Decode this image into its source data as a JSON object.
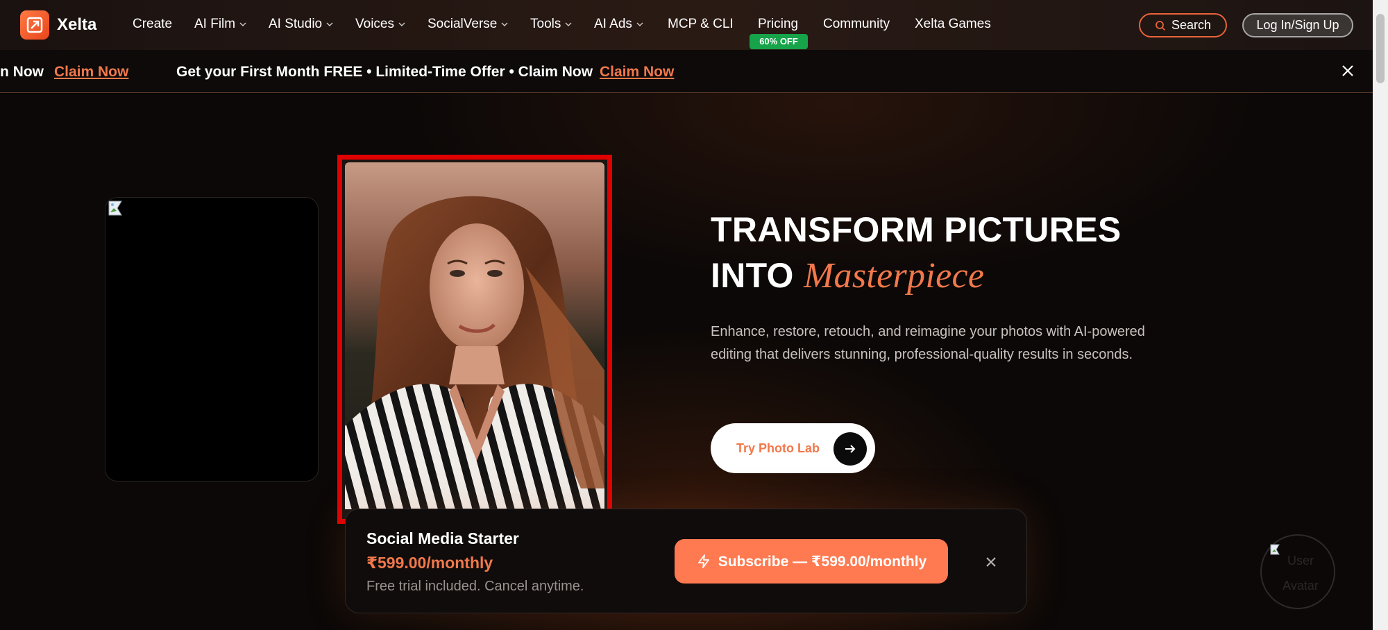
{
  "app": {
    "name": "Xelta"
  },
  "nav": {
    "items": [
      {
        "label": "Create",
        "dropdown": false
      },
      {
        "label": "AI Film",
        "dropdown": true
      },
      {
        "label": "AI Studio",
        "dropdown": true
      },
      {
        "label": "Voices",
        "dropdown": true
      },
      {
        "label": "SocialVerse",
        "dropdown": true
      },
      {
        "label": "Tools",
        "dropdown": true
      },
      {
        "label": "AI Ads",
        "dropdown": true
      },
      {
        "label": "MCP & CLI",
        "dropdown": false
      },
      {
        "label": "Pricing",
        "dropdown": false
      },
      {
        "label": "Community",
        "dropdown": false
      },
      {
        "label": "Xelta Games",
        "dropdown": false
      }
    ],
    "pricing_badge": "60% OFF",
    "search_label": "Search",
    "login_label": "Log In/Sign Up"
  },
  "promo": {
    "partial_text": "n Now",
    "text": "Get your First Month FREE • Limited-Time Offer • Claim Now",
    "link": "Claim Now"
  },
  "hero": {
    "title_line1": "TRANSFORM PICTURES",
    "title_line2_plain": "INTO",
    "title_line2_accent": "Masterpiece",
    "subtitle": "Enhance, restore, retouch, and reimagine your photos with AI-powered editing that delivers stunning, professional-quality results in seconds.",
    "cta_label": "Try Photo Lab"
  },
  "subscription": {
    "plan_name": "Social Media Starter",
    "price": "₹599.00/monthly",
    "note": "Free trial included. Cancel anytime.",
    "button_label": "Subscribe — ₹599.00/monthly"
  },
  "avatar": {
    "alt_text": "User Avatar"
  },
  "colors": {
    "accent": "#f2784b",
    "badge_green": "#16a34a",
    "highlight_red": "#e00000"
  }
}
